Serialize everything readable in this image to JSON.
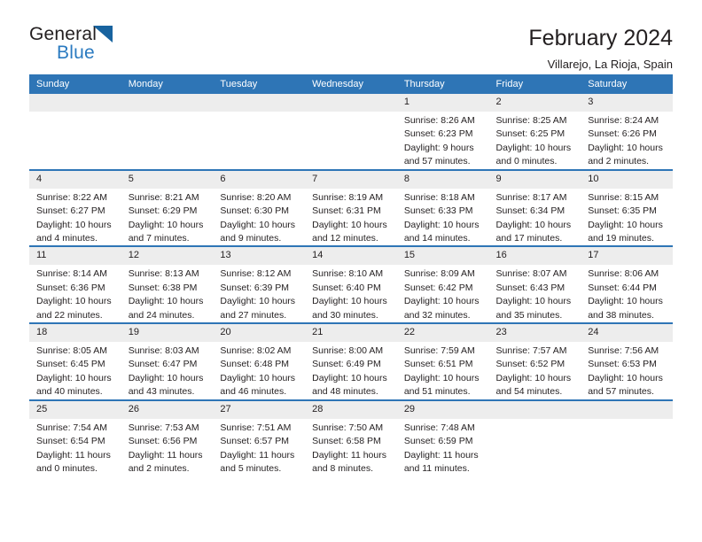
{
  "brand": {
    "name_top": "General",
    "name_bottom": "Blue",
    "triangle_color": "#18639f",
    "blue_color": "#2a7ac0"
  },
  "header": {
    "title": "February 2024",
    "subtitle": "Villarejo, La Rioja, Spain"
  },
  "theme": {
    "header_blue": "#2e75b6",
    "daynum_band": "#ededed",
    "text": "#231f20"
  },
  "weekday_headers": [
    "Sunday",
    "Monday",
    "Tuesday",
    "Wednesday",
    "Thursday",
    "Friday",
    "Saturday"
  ],
  "weeks": [
    [
      {
        "day": "",
        "lines": []
      },
      {
        "day": "",
        "lines": []
      },
      {
        "day": "",
        "lines": []
      },
      {
        "day": "",
        "lines": []
      },
      {
        "day": "1",
        "lines": [
          "Sunrise: 8:26 AM",
          "Sunset: 6:23 PM",
          "Daylight: 9 hours",
          "and 57 minutes."
        ]
      },
      {
        "day": "2",
        "lines": [
          "Sunrise: 8:25 AM",
          "Sunset: 6:25 PM",
          "Daylight: 10 hours",
          "and 0 minutes."
        ]
      },
      {
        "day": "3",
        "lines": [
          "Sunrise: 8:24 AM",
          "Sunset: 6:26 PM",
          "Daylight: 10 hours",
          "and 2 minutes."
        ]
      }
    ],
    [
      {
        "day": "4",
        "lines": [
          "Sunrise: 8:22 AM",
          "Sunset: 6:27 PM",
          "Daylight: 10 hours",
          "and 4 minutes."
        ]
      },
      {
        "day": "5",
        "lines": [
          "Sunrise: 8:21 AM",
          "Sunset: 6:29 PM",
          "Daylight: 10 hours",
          "and 7 minutes."
        ]
      },
      {
        "day": "6",
        "lines": [
          "Sunrise: 8:20 AM",
          "Sunset: 6:30 PM",
          "Daylight: 10 hours",
          "and 9 minutes."
        ]
      },
      {
        "day": "7",
        "lines": [
          "Sunrise: 8:19 AM",
          "Sunset: 6:31 PM",
          "Daylight: 10 hours",
          "and 12 minutes."
        ]
      },
      {
        "day": "8",
        "lines": [
          "Sunrise: 8:18 AM",
          "Sunset: 6:33 PM",
          "Daylight: 10 hours",
          "and 14 minutes."
        ]
      },
      {
        "day": "9",
        "lines": [
          "Sunrise: 8:17 AM",
          "Sunset: 6:34 PM",
          "Daylight: 10 hours",
          "and 17 minutes."
        ]
      },
      {
        "day": "10",
        "lines": [
          "Sunrise: 8:15 AM",
          "Sunset: 6:35 PM",
          "Daylight: 10 hours",
          "and 19 minutes."
        ]
      }
    ],
    [
      {
        "day": "11",
        "lines": [
          "Sunrise: 8:14 AM",
          "Sunset: 6:36 PM",
          "Daylight: 10 hours",
          "and 22 minutes."
        ]
      },
      {
        "day": "12",
        "lines": [
          "Sunrise: 8:13 AM",
          "Sunset: 6:38 PM",
          "Daylight: 10 hours",
          "and 24 minutes."
        ]
      },
      {
        "day": "13",
        "lines": [
          "Sunrise: 8:12 AM",
          "Sunset: 6:39 PM",
          "Daylight: 10 hours",
          "and 27 minutes."
        ]
      },
      {
        "day": "14",
        "lines": [
          "Sunrise: 8:10 AM",
          "Sunset: 6:40 PM",
          "Daylight: 10 hours",
          "and 30 minutes."
        ]
      },
      {
        "day": "15",
        "lines": [
          "Sunrise: 8:09 AM",
          "Sunset: 6:42 PM",
          "Daylight: 10 hours",
          "and 32 minutes."
        ]
      },
      {
        "day": "16",
        "lines": [
          "Sunrise: 8:07 AM",
          "Sunset: 6:43 PM",
          "Daylight: 10 hours",
          "and 35 minutes."
        ]
      },
      {
        "day": "17",
        "lines": [
          "Sunrise: 8:06 AM",
          "Sunset: 6:44 PM",
          "Daylight: 10 hours",
          "and 38 minutes."
        ]
      }
    ],
    [
      {
        "day": "18",
        "lines": [
          "Sunrise: 8:05 AM",
          "Sunset: 6:45 PM",
          "Daylight: 10 hours",
          "and 40 minutes."
        ]
      },
      {
        "day": "19",
        "lines": [
          "Sunrise: 8:03 AM",
          "Sunset: 6:47 PM",
          "Daylight: 10 hours",
          "and 43 minutes."
        ]
      },
      {
        "day": "20",
        "lines": [
          "Sunrise: 8:02 AM",
          "Sunset: 6:48 PM",
          "Daylight: 10 hours",
          "and 46 minutes."
        ]
      },
      {
        "day": "21",
        "lines": [
          "Sunrise: 8:00 AM",
          "Sunset: 6:49 PM",
          "Daylight: 10 hours",
          "and 48 minutes."
        ]
      },
      {
        "day": "22",
        "lines": [
          "Sunrise: 7:59 AM",
          "Sunset: 6:51 PM",
          "Daylight: 10 hours",
          "and 51 minutes."
        ]
      },
      {
        "day": "23",
        "lines": [
          "Sunrise: 7:57 AM",
          "Sunset: 6:52 PM",
          "Daylight: 10 hours",
          "and 54 minutes."
        ]
      },
      {
        "day": "24",
        "lines": [
          "Sunrise: 7:56 AM",
          "Sunset: 6:53 PM",
          "Daylight: 10 hours",
          "and 57 minutes."
        ]
      }
    ],
    [
      {
        "day": "25",
        "lines": [
          "Sunrise: 7:54 AM",
          "Sunset: 6:54 PM",
          "Daylight: 11 hours",
          "and 0 minutes."
        ]
      },
      {
        "day": "26",
        "lines": [
          "Sunrise: 7:53 AM",
          "Sunset: 6:56 PM",
          "Daylight: 11 hours",
          "and 2 minutes."
        ]
      },
      {
        "day": "27",
        "lines": [
          "Sunrise: 7:51 AM",
          "Sunset: 6:57 PM",
          "Daylight: 11 hours",
          "and 5 minutes."
        ]
      },
      {
        "day": "28",
        "lines": [
          "Sunrise: 7:50 AM",
          "Sunset: 6:58 PM",
          "Daylight: 11 hours",
          "and 8 minutes."
        ]
      },
      {
        "day": "29",
        "lines": [
          "Sunrise: 7:48 AM",
          "Sunset: 6:59 PM",
          "Daylight: 11 hours",
          "and 11 minutes."
        ]
      },
      {
        "day": "",
        "lines": []
      },
      {
        "day": "",
        "lines": []
      }
    ]
  ]
}
